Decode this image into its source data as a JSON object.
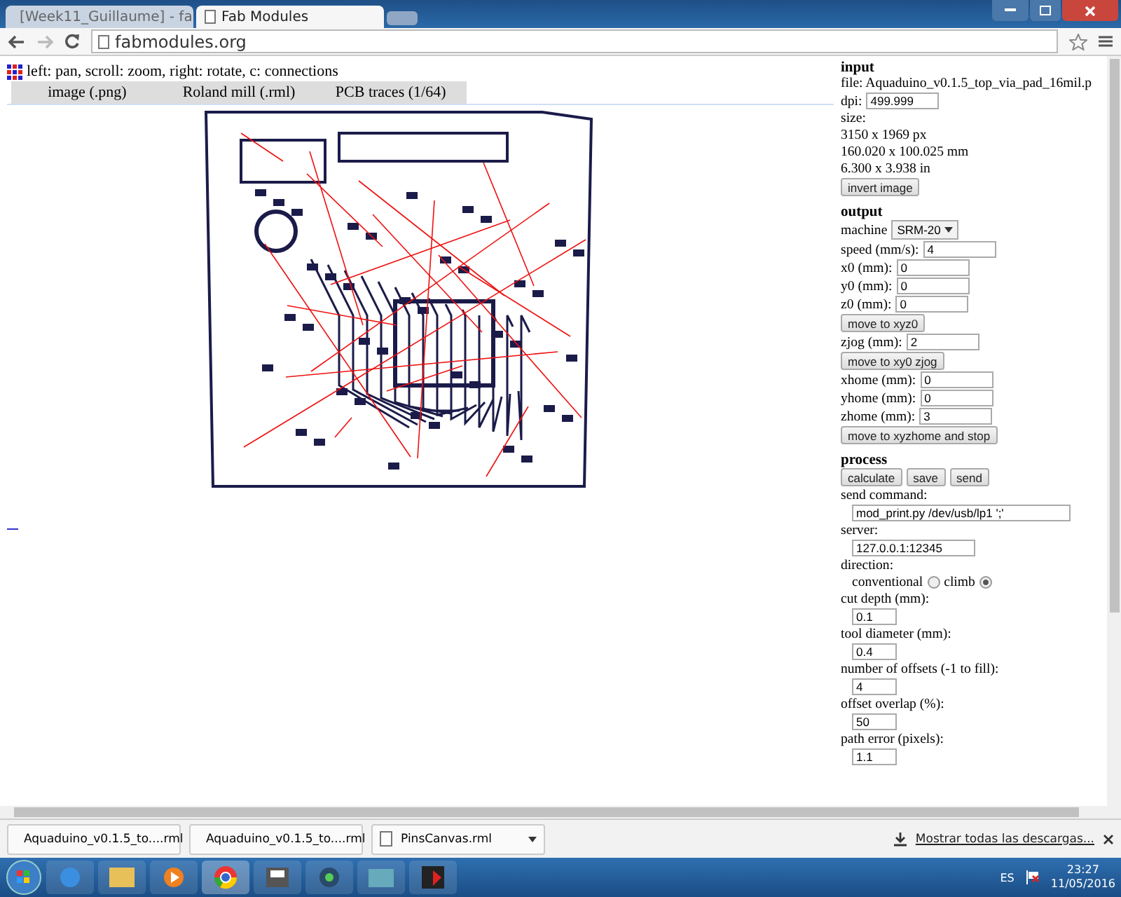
{
  "browser": {
    "tabs": [
      {
        "title": "[Week11_Guillaume] - fa",
        "selected": false
      },
      {
        "title": "Fab Modules",
        "selected": true
      }
    ],
    "address": "fabmodules.org"
  },
  "page": {
    "hint": "left: pan, scroll: zoom, right: rotate, c: connections",
    "menu": [
      "image (.png)",
      "Roland mill (.rml)",
      "PCB traces (1/64)"
    ],
    "panel": [
      {
        "title": "input",
        "rows": [
          {
            "kind": "text",
            "text": "file: Aquaduino_v0.1.5_top_via_pad_16mil.p"
          },
          {
            "kind": "field",
            "label": "dpi:",
            "value": "499.999"
          },
          {
            "kind": "text",
            "text": "size:"
          },
          {
            "kind": "text",
            "text": "3150 x 1969 px"
          },
          {
            "kind": "text",
            "text": "160.020 x 100.025 mm"
          },
          {
            "kind": "text",
            "text": "6.300 x 3.938 in"
          },
          {
            "kind": "button",
            "label": "invert image"
          }
        ]
      },
      {
        "title": "output",
        "rows": [
          {
            "kind": "select",
            "label": "machine",
            "value": "SRM-20"
          },
          {
            "kind": "field",
            "label": "speed (mm/s):",
            "value": "4"
          },
          {
            "kind": "field",
            "label": "x0 (mm):",
            "value": "0"
          },
          {
            "kind": "field",
            "label": "y0 (mm):",
            "value": "0"
          },
          {
            "kind": "field",
            "label": "z0 (mm):",
            "value": "0"
          },
          {
            "kind": "button",
            "label": "move to xyz0"
          },
          {
            "kind": "field",
            "label": "zjog (mm):",
            "value": "2"
          },
          {
            "kind": "button",
            "label": "move to xy0 zjog"
          },
          {
            "kind": "field",
            "label": "xhome (mm):",
            "value": "0"
          },
          {
            "kind": "field",
            "label": "yhome (mm):",
            "value": "0"
          },
          {
            "kind": "field",
            "label": "zhome (mm):",
            "value": "3"
          },
          {
            "kind": "button",
            "label": "move to xyzhome and stop"
          }
        ]
      },
      {
        "title": "process",
        "rows": [
          {
            "kind": "buttons",
            "labels": [
              "calculate",
              "save",
              "send"
            ]
          },
          {
            "kind": "text",
            "text": "send command:"
          },
          {
            "kind": "field",
            "value": "mod_print.py /dev/usb/lp1 ';'"
          },
          {
            "kind": "text",
            "text": "server:"
          },
          {
            "kind": "field",
            "value": "127.0.0.1:12345"
          },
          {
            "kind": "text",
            "text": "direction:"
          },
          {
            "kind": "radio",
            "options": [
              {
                "label": "conventional",
                "selected": false
              },
              {
                "label": "climb",
                "selected": true
              }
            ]
          },
          {
            "kind": "text",
            "text": "cut depth (mm):"
          },
          {
            "kind": "field",
            "value": "0.1"
          },
          {
            "kind": "text",
            "text": "tool diameter (mm):"
          },
          {
            "kind": "field",
            "value": "0.4"
          },
          {
            "kind": "text",
            "text": "number of offsets (-1 to fill):"
          },
          {
            "kind": "field",
            "value": "4"
          },
          {
            "kind": "text",
            "text": "offset overlap (%):"
          },
          {
            "kind": "field",
            "value": "50"
          },
          {
            "kind": "text",
            "text": "path error (pixels):"
          },
          {
            "kind": "field",
            "value": "1.1"
          }
        ]
      }
    ]
  },
  "downloads": {
    "items": [
      "Aquaduino_v0.1.5_to....rml",
      "Aquaduino_v0.1.5_to....rml",
      "PinsCanvas.rml"
    ],
    "show_all": "Mostrar todas las descargas..."
  },
  "taskbar": {
    "language": "ES",
    "time": "23:27",
    "date": "11/05/2016"
  }
}
